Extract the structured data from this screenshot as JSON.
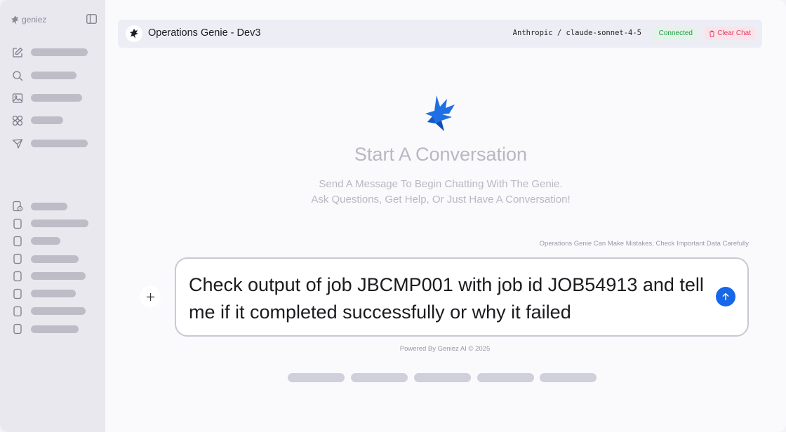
{
  "sidebar": {
    "brand": "geniez",
    "brand_icon": "geniez-logo-icon",
    "toggle_icon": "sidebar-toggle-icon",
    "nav_icons": [
      "new-chat-icon",
      "search-icon",
      "gallery-icon",
      "apps-icon",
      "send-icon"
    ],
    "history_icons": [
      "history-doc-icon",
      "chat-doc-icon",
      "chat-doc-icon",
      "chat-doc-icon",
      "chat-doc-icon",
      "chat-doc-icon",
      "chat-doc-icon",
      "chat-doc-icon"
    ]
  },
  "header": {
    "title": "Operations Genie - Dev3",
    "model": "Anthropic / claude-sonnet-4-5",
    "status": "Connected",
    "clear_label": "Clear Chat"
  },
  "hero": {
    "title": "Start A Conversation",
    "subtitle_line1": "Send A Message To Begin Chatting With The Genie.",
    "subtitle_line2": "Ask Questions, Get Help, Or Just Have A Conversation!"
  },
  "disclaimer": "Operations Genie Can Make Mistakes, Check Important Data Carefully",
  "composer": {
    "value": "Check output of job JBCMP001 with job id JOB54913 and tell me if it completed successfully or why it failed"
  },
  "footer": "Powered By Geniez AI © 2025",
  "colors": {
    "accent": "#1767e8",
    "connected": "#1f9a45",
    "danger": "#e23a64"
  }
}
